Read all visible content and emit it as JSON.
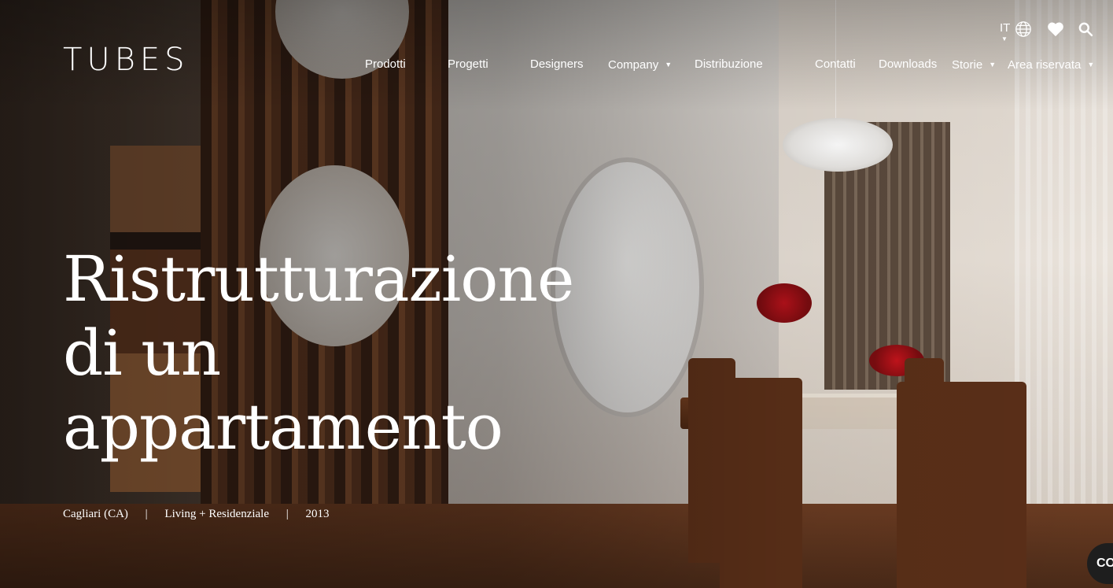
{
  "brand": {
    "logo_text": "TUBES"
  },
  "nav": {
    "items": [
      {
        "label": "Prodotti",
        "dropdown": false
      },
      {
        "label": "Progetti",
        "dropdown": false
      },
      {
        "label": "Designers",
        "dropdown": false
      },
      {
        "label": "Company",
        "dropdown": true
      },
      {
        "label": "Distribuzione",
        "dropdown": false
      },
      {
        "label": "Contatti",
        "dropdown": false
      },
      {
        "label": "Downloads",
        "dropdown": false
      },
      {
        "label": "Storie",
        "dropdown": true
      },
      {
        "label": "Area riservata",
        "dropdown": true
      }
    ],
    "caret_glyph": "▼"
  },
  "utility": {
    "language": "IT",
    "language_caret": "▼",
    "icons": [
      "globe-icon",
      "heart-icon",
      "search-icon"
    ]
  },
  "hero": {
    "title_lines": [
      "Ristrutturazione",
      "di un",
      "appartamento"
    ],
    "location": "Cagliari (CA)",
    "category": "Living + Residenziale",
    "year": "2013",
    "separator": "|"
  },
  "chat": {
    "label": "CO"
  },
  "colors": {
    "text": "#ffffff",
    "chat_bg": "#1e1e1e"
  }
}
